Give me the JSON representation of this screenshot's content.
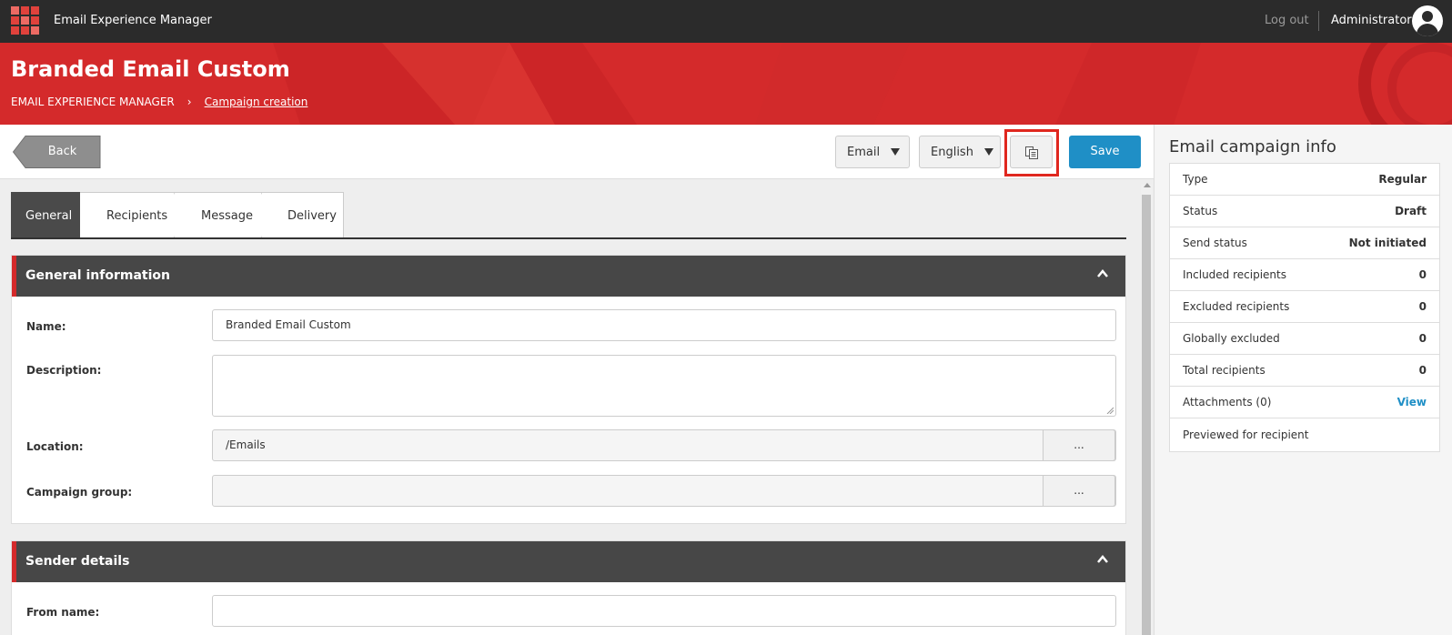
{
  "header": {
    "app_title": "Email Experience Manager",
    "logout_label": "Log out",
    "user_name": "Administrator"
  },
  "banner": {
    "page_title": "Branded Email Custom",
    "breadcrumb_root": "EMAIL EXPERIENCE MANAGER",
    "breadcrumb_current": "Campaign creation"
  },
  "toolbar": {
    "back_label": "Back",
    "channel_value": "Email",
    "language_value": "English",
    "save_label": "Save"
  },
  "tabs": [
    {
      "label": "General"
    },
    {
      "label": "Recipients"
    },
    {
      "label": "Message"
    },
    {
      "label": "Delivery"
    }
  ],
  "general": {
    "heading": "General information",
    "name_label": "Name:",
    "name_value": "Branded Email Custom",
    "description_label": "Description:",
    "description_value": "",
    "location_label": "Location:",
    "location_value": "/Emails",
    "campaign_group_label": "Campaign group:",
    "campaign_group_value": "",
    "browse_label": "..."
  },
  "sender": {
    "heading": "Sender details",
    "from_name_label": "From name:",
    "from_name_value": ""
  },
  "info_panel": {
    "title": "Email campaign info",
    "rows": [
      {
        "label": "Type",
        "value": "Regular"
      },
      {
        "label": "Status",
        "value": "Draft"
      },
      {
        "label": "Send status",
        "value": "Not initiated"
      },
      {
        "label": "Included recipients",
        "value": "0"
      },
      {
        "label": "Excluded recipients",
        "value": "0"
      },
      {
        "label": "Globally excluded",
        "value": "0"
      },
      {
        "label": "Total recipients",
        "value": "0"
      }
    ],
    "attachments_label": "Attachments (0)",
    "attachments_link": "View",
    "previewed_label": "Previewed for recipient"
  },
  "colors": {
    "accent_red": "#d42a2b",
    "save_blue": "#1f8fc6",
    "topbar": "#2b2b2b",
    "section_head": "#474747",
    "highlight_box": "#e0271f"
  }
}
